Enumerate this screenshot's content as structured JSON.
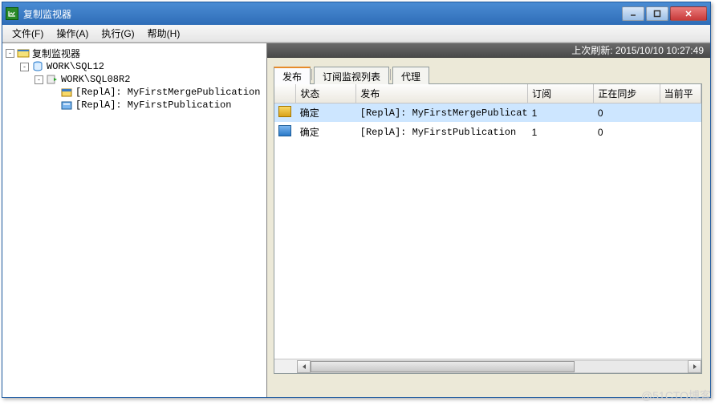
{
  "window": {
    "title": "复制监视器"
  },
  "menu": {
    "file": "文件(F)",
    "action": "操作(A)",
    "run": "执行(G)",
    "help": "帮助(H)"
  },
  "tree": {
    "root": "复制监视器",
    "group": "WORK\\SQL12",
    "server": "WORK\\SQL08R2",
    "pub1": "[ReplA]: MyFirstMergePublication",
    "pub2": "[ReplA]: MyFirstPublication"
  },
  "refresh": {
    "label": "上次刷新: 2015/10/10 10:27:49"
  },
  "tabs": {
    "pub": "发布",
    "watch": "订阅监视列表",
    "agent": "代理"
  },
  "grid": {
    "headers": {
      "status": "状态",
      "publication": "发布",
      "subscription": "订阅",
      "syncing": "正在同步",
      "current": "当前平"
    },
    "rows": [
      {
        "icon": "yellow",
        "status": "确定",
        "publication": "[ReplA]: MyFirstMergePublication",
        "subscription": "1",
        "syncing": "0"
      },
      {
        "icon": "blue",
        "status": "确定",
        "publication": "[ReplA]: MyFirstPublication",
        "subscription": "1",
        "syncing": "0"
      }
    ]
  },
  "watermark": "@51CTO博客"
}
